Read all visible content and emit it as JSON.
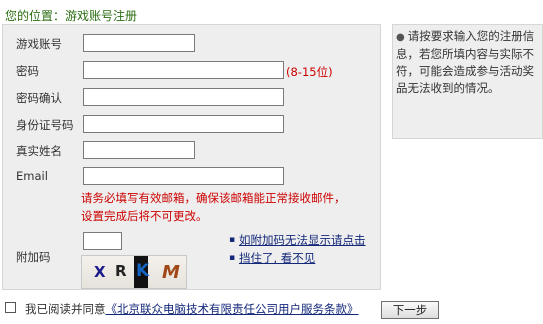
{
  "breadcrumb": "您的位置：游戏账号注册",
  "form": {
    "fields": {
      "account": {
        "label": "游戏账号",
        "value": ""
      },
      "password": {
        "label": "密码",
        "value": "",
        "hint": "(8-15位)"
      },
      "confirm": {
        "label": "密码确认",
        "value": ""
      },
      "idcard": {
        "label": "身份证号码",
        "value": ""
      },
      "realname": {
        "label": "真实姓名",
        "value": ""
      },
      "email": {
        "label": "Email",
        "value": ""
      }
    },
    "email_warning": [
      "请务必填写有效邮箱，确保该邮箱能正常接收邮件，",
      "设置完成后将不可更改。"
    ],
    "captcha": {
      "label": "附加码",
      "value": "",
      "image_text": [
        "X",
        "R",
        "K",
        "M"
      ]
    },
    "links": [
      "如附加码无法显示请点击",
      "挡住了, 看不见"
    ]
  },
  "info": {
    "bullet": "●",
    "text": "请按要求输入您的注册信息，若您所填内容与实际不符，可能会造成参与活动奖品无法收到的情况。"
  },
  "agreement": {
    "checked": false,
    "prefix": "我已阅读并同意",
    "link": "《北京联众电脑技术有限责任公司用户服务条款》",
    "next_button": "下一步"
  }
}
